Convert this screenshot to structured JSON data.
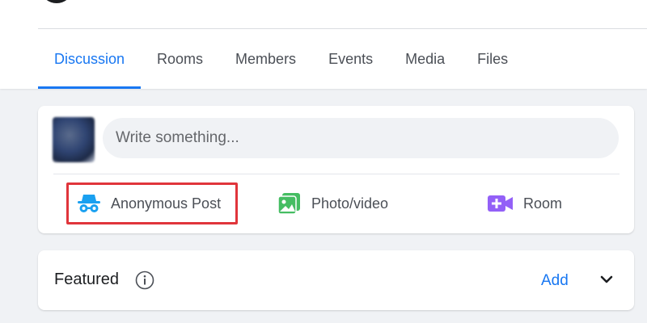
{
  "tabs": [
    {
      "label": "Discussion",
      "active": true
    },
    {
      "label": "Rooms"
    },
    {
      "label": "Members"
    },
    {
      "label": "Events"
    },
    {
      "label": "Media"
    },
    {
      "label": "Files"
    }
  ],
  "composer": {
    "placeholder": "Write something...",
    "actions": {
      "anonymous": {
        "label": "Anonymous Post",
        "icon": "incognito-icon",
        "color": "#1aa0f0",
        "highlight_color": "#e0353b"
      },
      "photo": {
        "label": "Photo/video",
        "icon": "photo-icon",
        "color": "#45bd62"
      },
      "room": {
        "label": "Room",
        "icon": "video-add-icon",
        "color": "#9360f7"
      }
    }
  },
  "featured": {
    "title": "Featured",
    "add_label": "Add"
  },
  "colors": {
    "accent": "#1877f2",
    "page_bg": "#f0f2f5"
  }
}
